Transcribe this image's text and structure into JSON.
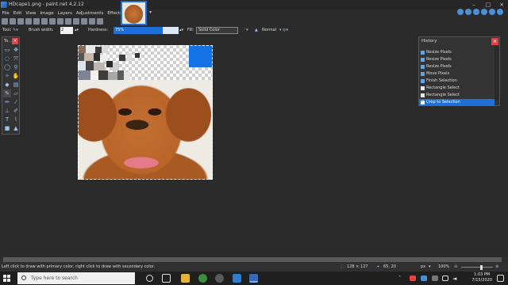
{
  "window": {
    "title": "HDcape1.png - paint.net 4.2.12"
  },
  "menu": [
    "File",
    "Edit",
    "View",
    "Image",
    "Layers",
    "Adjustments",
    "Effects"
  ],
  "options": {
    "tool_label": "Tool:",
    "brush_width_label": "Brush width:",
    "brush_width_value": "2",
    "hardness_label": "Hardness:",
    "hardness_value": "75%",
    "hardness_fraction": 0.75,
    "fill_label": "Fill:",
    "fill_value": "Solid Color",
    "blend_value": "Normal"
  },
  "tools_panel": {
    "title": "To...",
    "close": "×"
  },
  "history": {
    "title": "History",
    "close": "×",
    "items": [
      {
        "label": "Resize Pixels",
        "selected": false
      },
      {
        "label": "Resize Pixels",
        "selected": false
      },
      {
        "label": "Resize Pixels",
        "selected": false
      },
      {
        "label": "Move Pixels",
        "selected": false
      },
      {
        "label": "Finish Selection",
        "selected": false
      },
      {
        "label": "Rectangle Select",
        "selected": false
      },
      {
        "label": "Rectangle Select",
        "selected": false
      },
      {
        "label": "Crop to Selection",
        "selected": true
      }
    ]
  },
  "status": {
    "message": "Left click to draw with primary color, right click to draw with secondary color.",
    "selection_size": "128 × 127",
    "cursor_pos": "65, 20",
    "units": "px",
    "zoom": "100%"
  },
  "taskbar": {
    "search_placeholder": "Type here to search",
    "time": "1:03 PM",
    "date": "7/15/2020"
  },
  "colors": {
    "accent": "#1e6fd9",
    "close_red": "#e04343"
  }
}
